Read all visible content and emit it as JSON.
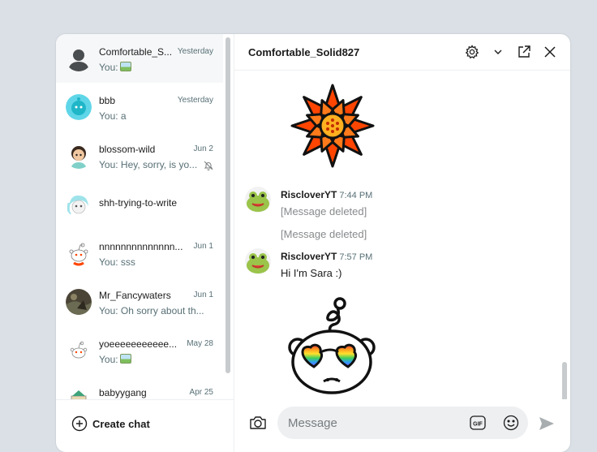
{
  "sidebar": {
    "conversations": [
      {
        "name": "Comfortable_S...",
        "date": "Yesterday",
        "preview": "You:",
        "preview_image_icon": "image-icon"
      },
      {
        "name": "bbb",
        "date": "Yesterday",
        "preview": "You: a"
      },
      {
        "name": "blossom-wild",
        "date": "Jun 2",
        "preview": "You: Hey, sorry, is yo...",
        "muted_icon": "bell-off-icon"
      },
      {
        "name": "shh-trying-to-write",
        "date": "",
        "preview": ""
      },
      {
        "name": "nnnnnnnnnnnnnn...",
        "date": "Jun 1",
        "preview": "You: sss"
      },
      {
        "name": "Mr_Fancywaters",
        "date": "Jun 1",
        "preview": "You: Oh sorry about th..."
      },
      {
        "name": "yoeeeeeeeeeee...",
        "date": "May 28",
        "preview": "You:",
        "preview_image_icon": "image-icon"
      },
      {
        "name": "babyygang",
        "date": "Apr 25",
        "preview": ""
      }
    ],
    "create_chat_label": "Create chat",
    "create_chat_icon": "plus-circle-icon"
  },
  "chat": {
    "title": "Comfortable_Solid827",
    "header_icons": [
      "gear-icon",
      "chevron-down-icon",
      "open-external-icon",
      "close-icon"
    ],
    "messages": [
      {
        "author": "RiscloverYT",
        "time": "7:44 PM",
        "lines": [
          "[Message deleted]",
          "[Message deleted]"
        ]
      },
      {
        "author": "RiscloverYT",
        "time": "7:57 PM",
        "lines": [
          "Hi I'm Sara :)"
        ]
      }
    ],
    "stickers": [
      "orange-flower-sticker",
      "rainbow-heart-glasses-snoo-sticker"
    ]
  },
  "composer": {
    "placeholder": "Message",
    "camera_icon": "camera-icon",
    "gif_icon": "gif-icon",
    "emoji_icon": "emoji-icon",
    "send_icon": "send-icon"
  },
  "colors": {
    "background": "#dae0e6",
    "active_row": "#f6f7f8",
    "flower_orange": "#ff4500",
    "muted_text": "#576f76",
    "deleted_text": "#878a8c"
  }
}
